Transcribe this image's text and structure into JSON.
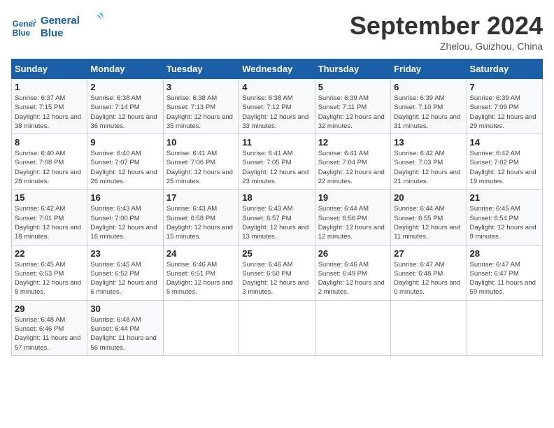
{
  "header": {
    "logo_line1": "General",
    "logo_line2": "Blue",
    "month": "September 2024",
    "location": "Zhelou, Guizhou, China"
  },
  "weekdays": [
    "Sunday",
    "Monday",
    "Tuesday",
    "Wednesday",
    "Thursday",
    "Friday",
    "Saturday"
  ],
  "weeks": [
    [
      {
        "day": "1",
        "sunrise": "6:37 AM",
        "sunset": "7:15 PM",
        "daylight": "12 hours and 38 minutes."
      },
      {
        "day": "2",
        "sunrise": "6:38 AM",
        "sunset": "7:14 PM",
        "daylight": "12 hours and 36 minutes."
      },
      {
        "day": "3",
        "sunrise": "6:38 AM",
        "sunset": "7:13 PM",
        "daylight": "12 hours and 35 minutes."
      },
      {
        "day": "4",
        "sunrise": "6:38 AM",
        "sunset": "7:12 PM",
        "daylight": "12 hours and 33 minutes."
      },
      {
        "day": "5",
        "sunrise": "6:39 AM",
        "sunset": "7:11 PM",
        "daylight": "12 hours and 32 minutes."
      },
      {
        "day": "6",
        "sunrise": "6:39 AM",
        "sunset": "7:10 PM",
        "daylight": "12 hours and 31 minutes."
      },
      {
        "day": "7",
        "sunrise": "6:39 AM",
        "sunset": "7:09 PM",
        "daylight": "12 hours and 29 minutes."
      }
    ],
    [
      {
        "day": "8",
        "sunrise": "6:40 AM",
        "sunset": "7:08 PM",
        "daylight": "12 hours and 28 minutes."
      },
      {
        "day": "9",
        "sunrise": "6:40 AM",
        "sunset": "7:07 PM",
        "daylight": "12 hours and 26 minutes."
      },
      {
        "day": "10",
        "sunrise": "6:41 AM",
        "sunset": "7:06 PM",
        "daylight": "12 hours and 25 minutes."
      },
      {
        "day": "11",
        "sunrise": "6:41 AM",
        "sunset": "7:05 PM",
        "daylight": "12 hours and 23 minutes."
      },
      {
        "day": "12",
        "sunrise": "6:41 AM",
        "sunset": "7:04 PM",
        "daylight": "12 hours and 22 minutes."
      },
      {
        "day": "13",
        "sunrise": "6:42 AM",
        "sunset": "7:03 PM",
        "daylight": "12 hours and 21 minutes."
      },
      {
        "day": "14",
        "sunrise": "6:42 AM",
        "sunset": "7:02 PM",
        "daylight": "12 hours and 19 minutes."
      }
    ],
    [
      {
        "day": "15",
        "sunrise": "6:42 AM",
        "sunset": "7:01 PM",
        "daylight": "12 hours and 18 minutes."
      },
      {
        "day": "16",
        "sunrise": "6:43 AM",
        "sunset": "7:00 PM",
        "daylight": "12 hours and 16 minutes."
      },
      {
        "day": "17",
        "sunrise": "6:43 AM",
        "sunset": "6:58 PM",
        "daylight": "12 hours and 15 minutes."
      },
      {
        "day": "18",
        "sunrise": "6:43 AM",
        "sunset": "6:57 PM",
        "daylight": "12 hours and 13 minutes."
      },
      {
        "day": "19",
        "sunrise": "6:44 AM",
        "sunset": "6:56 PM",
        "daylight": "12 hours and 12 minutes."
      },
      {
        "day": "20",
        "sunrise": "6:44 AM",
        "sunset": "6:55 PM",
        "daylight": "12 hours and 11 minutes."
      },
      {
        "day": "21",
        "sunrise": "6:45 AM",
        "sunset": "6:54 PM",
        "daylight": "12 hours and 9 minutes."
      }
    ],
    [
      {
        "day": "22",
        "sunrise": "6:45 AM",
        "sunset": "6:53 PM",
        "daylight": "12 hours and 8 minutes."
      },
      {
        "day": "23",
        "sunrise": "6:45 AM",
        "sunset": "6:52 PM",
        "daylight": "12 hours and 6 minutes."
      },
      {
        "day": "24",
        "sunrise": "6:46 AM",
        "sunset": "6:51 PM",
        "daylight": "12 hours and 5 minutes."
      },
      {
        "day": "25",
        "sunrise": "6:46 AM",
        "sunset": "6:50 PM",
        "daylight": "12 hours and 3 minutes."
      },
      {
        "day": "26",
        "sunrise": "6:46 AM",
        "sunset": "6:49 PM",
        "daylight": "12 hours and 2 minutes."
      },
      {
        "day": "27",
        "sunrise": "6:47 AM",
        "sunset": "6:48 PM",
        "daylight": "12 hours and 0 minutes."
      },
      {
        "day": "28",
        "sunrise": "6:47 AM",
        "sunset": "6:47 PM",
        "daylight": "11 hours and 59 minutes."
      }
    ],
    [
      {
        "day": "29",
        "sunrise": "6:48 AM",
        "sunset": "6:46 PM",
        "daylight": "11 hours and 57 minutes."
      },
      {
        "day": "30",
        "sunrise": "6:48 AM",
        "sunset": "6:44 PM",
        "daylight": "11 hours and 56 minutes."
      },
      null,
      null,
      null,
      null,
      null
    ]
  ]
}
